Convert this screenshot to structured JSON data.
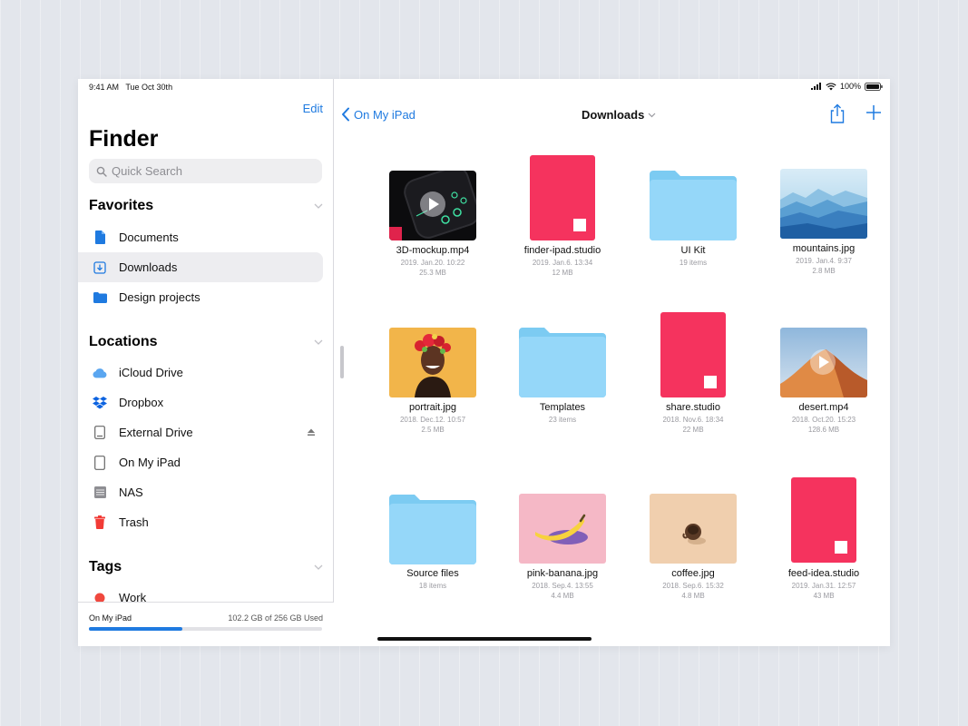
{
  "status": {
    "time": "9:41 AM",
    "date": "Tue Oct 30th",
    "battery": "100%"
  },
  "sidebar": {
    "edit_label": "Edit",
    "title": "Finder",
    "search_placeholder": "Quick Search",
    "favorites": {
      "label": "Favorites",
      "items": [
        {
          "label": "Documents",
          "icon": "document-icon"
        },
        {
          "label": "Downloads",
          "icon": "downloads-icon",
          "selected": true
        },
        {
          "label": "Design projects",
          "icon": "folder-icon"
        }
      ]
    },
    "locations": {
      "label": "Locations",
      "items": [
        {
          "label": "iCloud Drive",
          "icon": "icloud-icon"
        },
        {
          "label": "Dropbox",
          "icon": "dropbox-icon"
        },
        {
          "label": "External Drive",
          "icon": "external-drive-icon"
        },
        {
          "label": "On My iPad",
          "icon": "ipad-icon"
        },
        {
          "label": "NAS",
          "icon": "nas-icon"
        },
        {
          "label": "Trash",
          "icon": "trash-icon"
        }
      ]
    },
    "tags": {
      "label": "Tags",
      "items": [
        {
          "label": "Work",
          "color": "#f0483e"
        }
      ]
    },
    "storage": {
      "device": "On My iPad",
      "usage": "102.2 GB of 256 GB Used",
      "fraction": 0.4
    }
  },
  "toolbar": {
    "back_label": "On My iPad",
    "title": "Downloads"
  },
  "files": [
    {
      "name": "3D-mockup.mp4",
      "date": "2019. Jan.20. 10:22",
      "size": "25.3 MB",
      "kind": "video-dark"
    },
    {
      "name": "finder-ipad.studio",
      "date": "2019. Jan.6. 13:34",
      "size": "12 MB",
      "kind": "studio"
    },
    {
      "name": "UI Kit",
      "date": "19 items",
      "size": "",
      "kind": "folder"
    },
    {
      "name": "mountains.jpg",
      "date": "2019. Jan.4. 9:37",
      "size": "2.8 MB",
      "kind": "mountains"
    },
    {
      "name": "portrait.jpg",
      "date": "2018. Dec.12. 10:57",
      "size": "2.5 MB",
      "kind": "portrait"
    },
    {
      "name": "Templates",
      "date": "23 items",
      "size": "",
      "kind": "folder"
    },
    {
      "name": "share.studio",
      "date": "2018. Nov.6. 18:34",
      "size": "22 MB",
      "kind": "studio"
    },
    {
      "name": "desert.mp4",
      "date": "2018. Oct.20. 15:23",
      "size": "128.6 MB",
      "kind": "desert"
    },
    {
      "name": "Source files",
      "date": "18 items",
      "size": "",
      "kind": "folder"
    },
    {
      "name": "pink-banana.jpg",
      "date": "2018. Sep.4. 13:55",
      "size": "4.4 MB",
      "kind": "banana"
    },
    {
      "name": "coffee.jpg",
      "date": "2018. Sep.6. 15:32",
      "size": "4.8 MB",
      "kind": "coffee"
    },
    {
      "name": "feed-idea.studio",
      "date": "2019. Jan.31. 12:57",
      "size": "43 MB",
      "kind": "studio"
    }
  ],
  "colors": {
    "accent": "#1f7ae0",
    "studio": "#f5335e",
    "folder": "#8fd3f7",
    "tag_work": "#f0483e"
  }
}
